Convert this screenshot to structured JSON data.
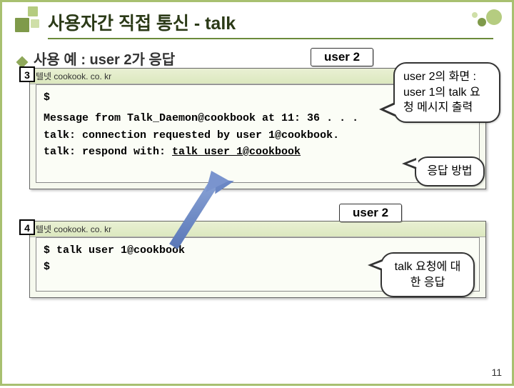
{
  "title": "사용자간 직접 통신 - talk",
  "bullet": "사용 예 : user 2가 응답",
  "user_tag_1": "user 2",
  "user_tag_2": "user 2",
  "num_1": "3",
  "num_2": "4",
  "term1": {
    "titlebar": "텔넷  cookook. co. kr",
    "lines": {
      "prompt": "$",
      "l1": "Message from Talk_Daemon@cookbook at 11: 36 . . .",
      "l2": "talk: connection requested by user 1@cookbook.",
      "l3_prefix": "talk: respond with:  ",
      "l3_cmd": "talk user 1@cookbook"
    }
  },
  "term2": {
    "titlebar": "텔넷  cookook. co. kr",
    "lines": {
      "l1": "$ talk user 1@cookbook",
      "l2": "$"
    }
  },
  "callouts": {
    "c1": "user 2의 화면 : user 1의 talk 요청 메시지 출력",
    "c2": "응답 방법",
    "c3": "talk 요청에 대한 응답"
  },
  "page_number": "11"
}
